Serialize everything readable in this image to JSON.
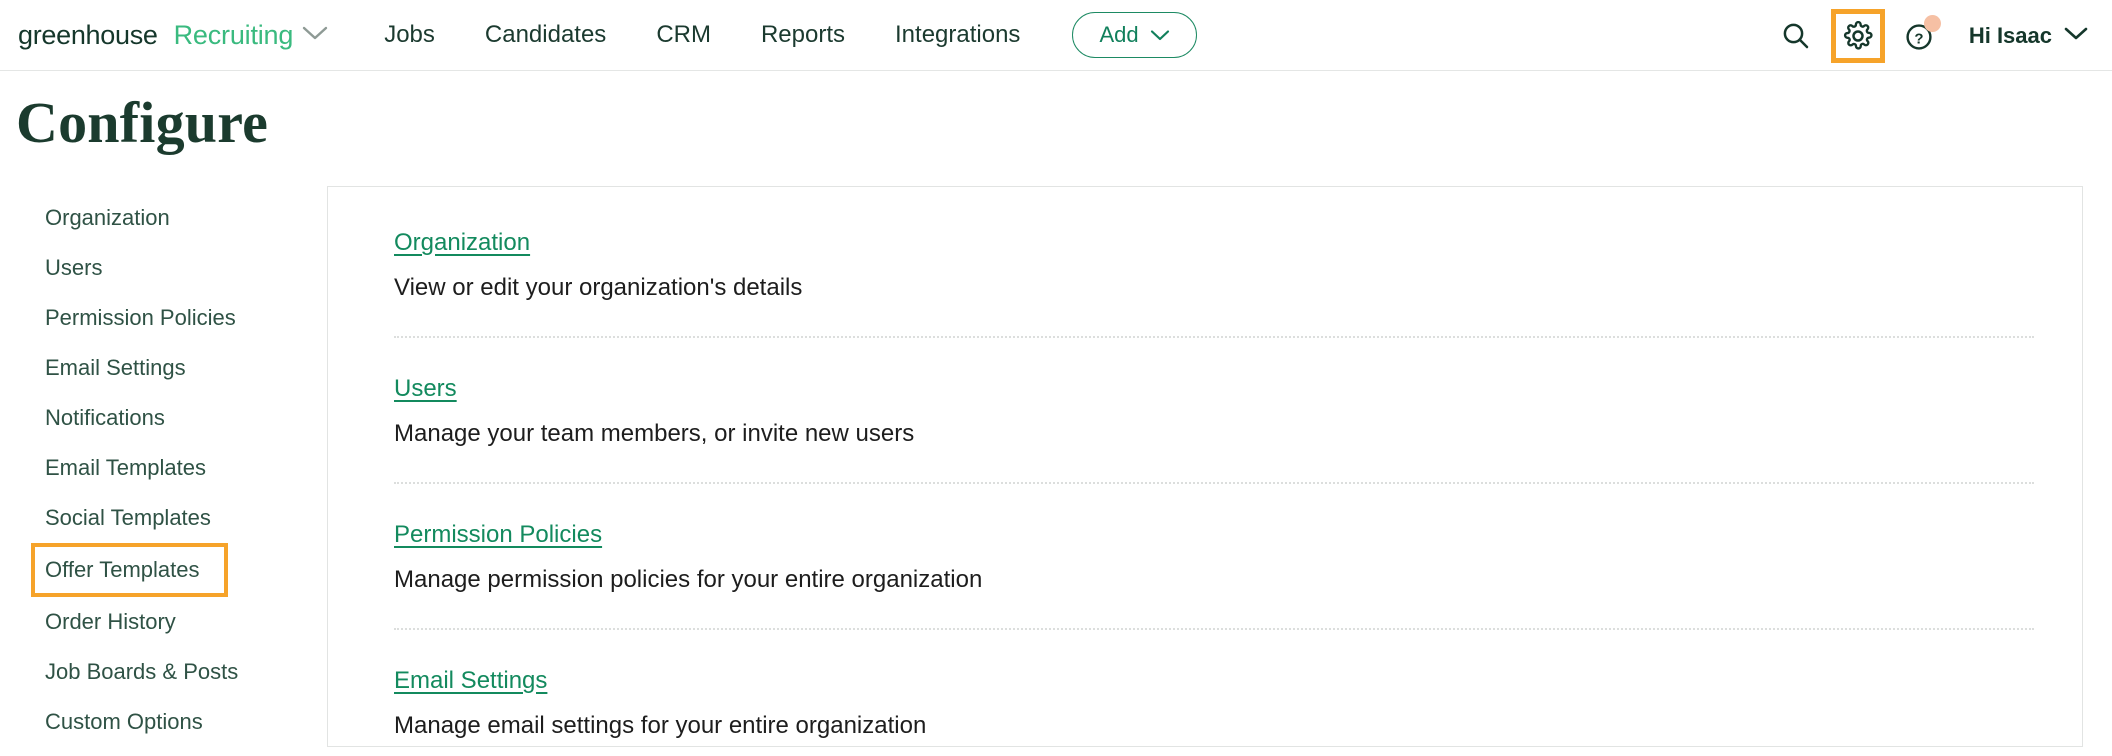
{
  "brand": {
    "primary": "greenhouse",
    "secondary": "Recruiting",
    "chevron_icon": "chevron-down-icon"
  },
  "nav": {
    "links": [
      {
        "label": "Jobs"
      },
      {
        "label": "Candidates"
      },
      {
        "label": "CRM"
      },
      {
        "label": "Reports"
      },
      {
        "label": "Integrations"
      }
    ],
    "add_button": {
      "label": "Add",
      "chevron_icon": "chevron-down-icon"
    },
    "right": {
      "search_icon": "search-icon",
      "settings_icon": "gear-icon",
      "help_icon": "question-circle-icon",
      "help_badge": "notification-dot",
      "greeting": "Hi Isaac",
      "greeting_chevron": "chevron-down-icon"
    }
  },
  "page": {
    "title": "Configure"
  },
  "sidebar": {
    "items": [
      {
        "label": "Organization",
        "selected": false
      },
      {
        "label": "Users",
        "selected": false
      },
      {
        "label": "Permission Policies",
        "selected": false
      },
      {
        "label": "Email Settings",
        "selected": false
      },
      {
        "label": "Notifications",
        "selected": false
      },
      {
        "label": "Email Templates",
        "selected": false
      },
      {
        "label": "Social Templates",
        "selected": false
      },
      {
        "label": "Offer Templates",
        "selected": true
      },
      {
        "label": "Order History",
        "selected": false
      },
      {
        "label": "Job Boards & Posts",
        "selected": false
      },
      {
        "label": "Custom Options",
        "selected": false
      }
    ]
  },
  "main": {
    "rows": [
      {
        "link": "Organization",
        "description": "View or edit your organization's details"
      },
      {
        "link": "Users",
        "description": "Manage your team members, or invite new users"
      },
      {
        "link": "Permission Policies",
        "description": "Manage permission policies for your entire organization"
      },
      {
        "link": "Email Settings",
        "description": "Manage email settings for your entire organization"
      }
    ]
  },
  "colors": {
    "brand_green": "#3aba7f",
    "link_green": "#138a5e",
    "dark_green": "#15372b",
    "highlight_orange": "#f6a32a",
    "badge_peach": "#f6c0a4",
    "border_gray": "#e2e4e3"
  }
}
